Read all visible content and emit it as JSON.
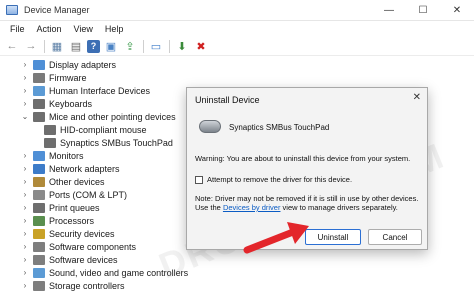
{
  "window": {
    "title": "Device Manager",
    "controls": {
      "minimize": "—",
      "maximize": "☐",
      "close": "✕"
    }
  },
  "menu": [
    "File",
    "Action",
    "View",
    "Help"
  ],
  "toolbar": {
    "buttons": [
      {
        "icon": "back-arrow-icon",
        "glyph": "←"
      },
      {
        "icon": "forward-arrow-icon",
        "glyph": "→"
      },
      {
        "icon": "properties-icon",
        "glyph": "▦"
      },
      {
        "icon": "tree-view-icon",
        "glyph": "▤"
      },
      {
        "icon": "help-icon",
        "glyph": "?"
      },
      {
        "icon": "scan-hardware-icon",
        "glyph": "▣"
      },
      {
        "icon": "update-driver-icon",
        "glyph": "⇪"
      },
      {
        "icon": "monitor-icon",
        "glyph": "▭"
      },
      {
        "icon": "enable-device-icon",
        "glyph": "⬇"
      },
      {
        "icon": "uninstall-device-icon",
        "glyph": "✖"
      }
    ]
  },
  "tree": [
    {
      "label": "Display adapters",
      "expanded": false,
      "level": 0,
      "color": "#4f8fd6"
    },
    {
      "label": "Firmware",
      "expanded": false,
      "level": 0,
      "color": "#7a7a7a"
    },
    {
      "label": "Human Interface Devices",
      "expanded": false,
      "level": 0,
      "color": "#5c9bd5"
    },
    {
      "label": "Keyboards",
      "expanded": false,
      "level": 0,
      "color": "#6e6e6e"
    },
    {
      "label": "Mice and other pointing devices",
      "expanded": true,
      "level": 0,
      "color": "#6e6e6e"
    },
    {
      "label": "HID-compliant mouse",
      "expanded": null,
      "level": 1,
      "color": "#6e6e6e"
    },
    {
      "label": "Synaptics SMBus TouchPad",
      "expanded": null,
      "level": 1,
      "color": "#6e6e6e"
    },
    {
      "label": "Monitors",
      "expanded": false,
      "level": 0,
      "color": "#4f8fd6"
    },
    {
      "label": "Network adapters",
      "expanded": false,
      "level": 0,
      "color": "#3d7cc9"
    },
    {
      "label": "Other devices",
      "expanded": false,
      "level": 0,
      "color": "#b08a3a"
    },
    {
      "label": "Ports (COM & LPT)",
      "expanded": false,
      "level": 0,
      "color": "#8a8a8a"
    },
    {
      "label": "Print queues",
      "expanded": false,
      "level": 0,
      "color": "#6e6e6e"
    },
    {
      "label": "Processors",
      "expanded": false,
      "level": 0,
      "color": "#5a8f4f"
    },
    {
      "label": "Security devices",
      "expanded": false,
      "level": 0,
      "color": "#c9a227"
    },
    {
      "label": "Software components",
      "expanded": false,
      "level": 0,
      "color": "#7e7e7e"
    },
    {
      "label": "Software devices",
      "expanded": false,
      "level": 0,
      "color": "#7e7e7e"
    },
    {
      "label": "Sound, video and game controllers",
      "expanded": false,
      "level": 0,
      "color": "#5c9bd5"
    },
    {
      "label": "Storage controllers",
      "expanded": false,
      "level": 0,
      "color": "#7e7e7e"
    }
  ],
  "dialog": {
    "title": "Uninstall Device",
    "close": "✕",
    "device_name": "Synaptics SMBus TouchPad",
    "warning": "Warning: You are about to uninstall this device from your system.",
    "checkbox_label": "Attempt to remove the driver for this device.",
    "checkbox_checked": false,
    "note_before": "Note: Driver may not be removed if it is still in use by other devices. Use the ",
    "note_link": "Devices by driver",
    "note_after": " view to manage drivers separately.",
    "uninstall_label": "Uninstall",
    "cancel_label": "Cancel"
  },
  "watermark": "DROIDWIN.COM",
  "colors": {
    "accent": "#2b6fd3",
    "arrow": "#e3262b",
    "link": "#0b5cc4"
  }
}
